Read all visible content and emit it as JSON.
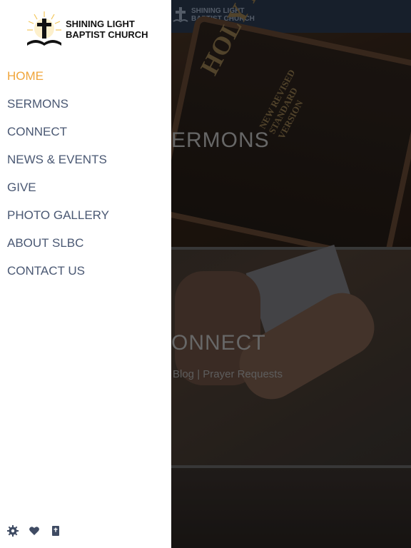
{
  "brand": {
    "line1": "SHINING LIGHT",
    "line2": "BAPTIST CHURCH",
    "icon": "cross-open-book-icon"
  },
  "menu": {
    "items": [
      {
        "label": "HOME",
        "active": true
      },
      {
        "label": "SERMONS",
        "active": false
      },
      {
        "label": "CONNECT",
        "active": false
      },
      {
        "label": "NEWS & EVENTS",
        "active": false
      },
      {
        "label": "GIVE",
        "active": false
      },
      {
        "label": "PHOTO GALLERY",
        "active": false
      },
      {
        "label": "ABOUT SLBC",
        "active": false
      },
      {
        "label": "CONTACT US",
        "active": false
      }
    ]
  },
  "footer_icons": [
    "gear-icon",
    "heart-icon",
    "bible-book-icon"
  ],
  "background": {
    "panels": [
      {
        "title": "ERMONS",
        "book_title": "HOLY BIBLE",
        "book_subtitle": "NEW REVISED STANDARD VERSION"
      },
      {
        "title": "ONNECT",
        "links": "Blog | Prayer Requests"
      },
      {
        "title": ""
      }
    ]
  },
  "colors": {
    "accent": "#f0a53a",
    "menu_text": "#4a5873",
    "topbar": "#1f2a3a",
    "drawer": "#ffffff"
  }
}
